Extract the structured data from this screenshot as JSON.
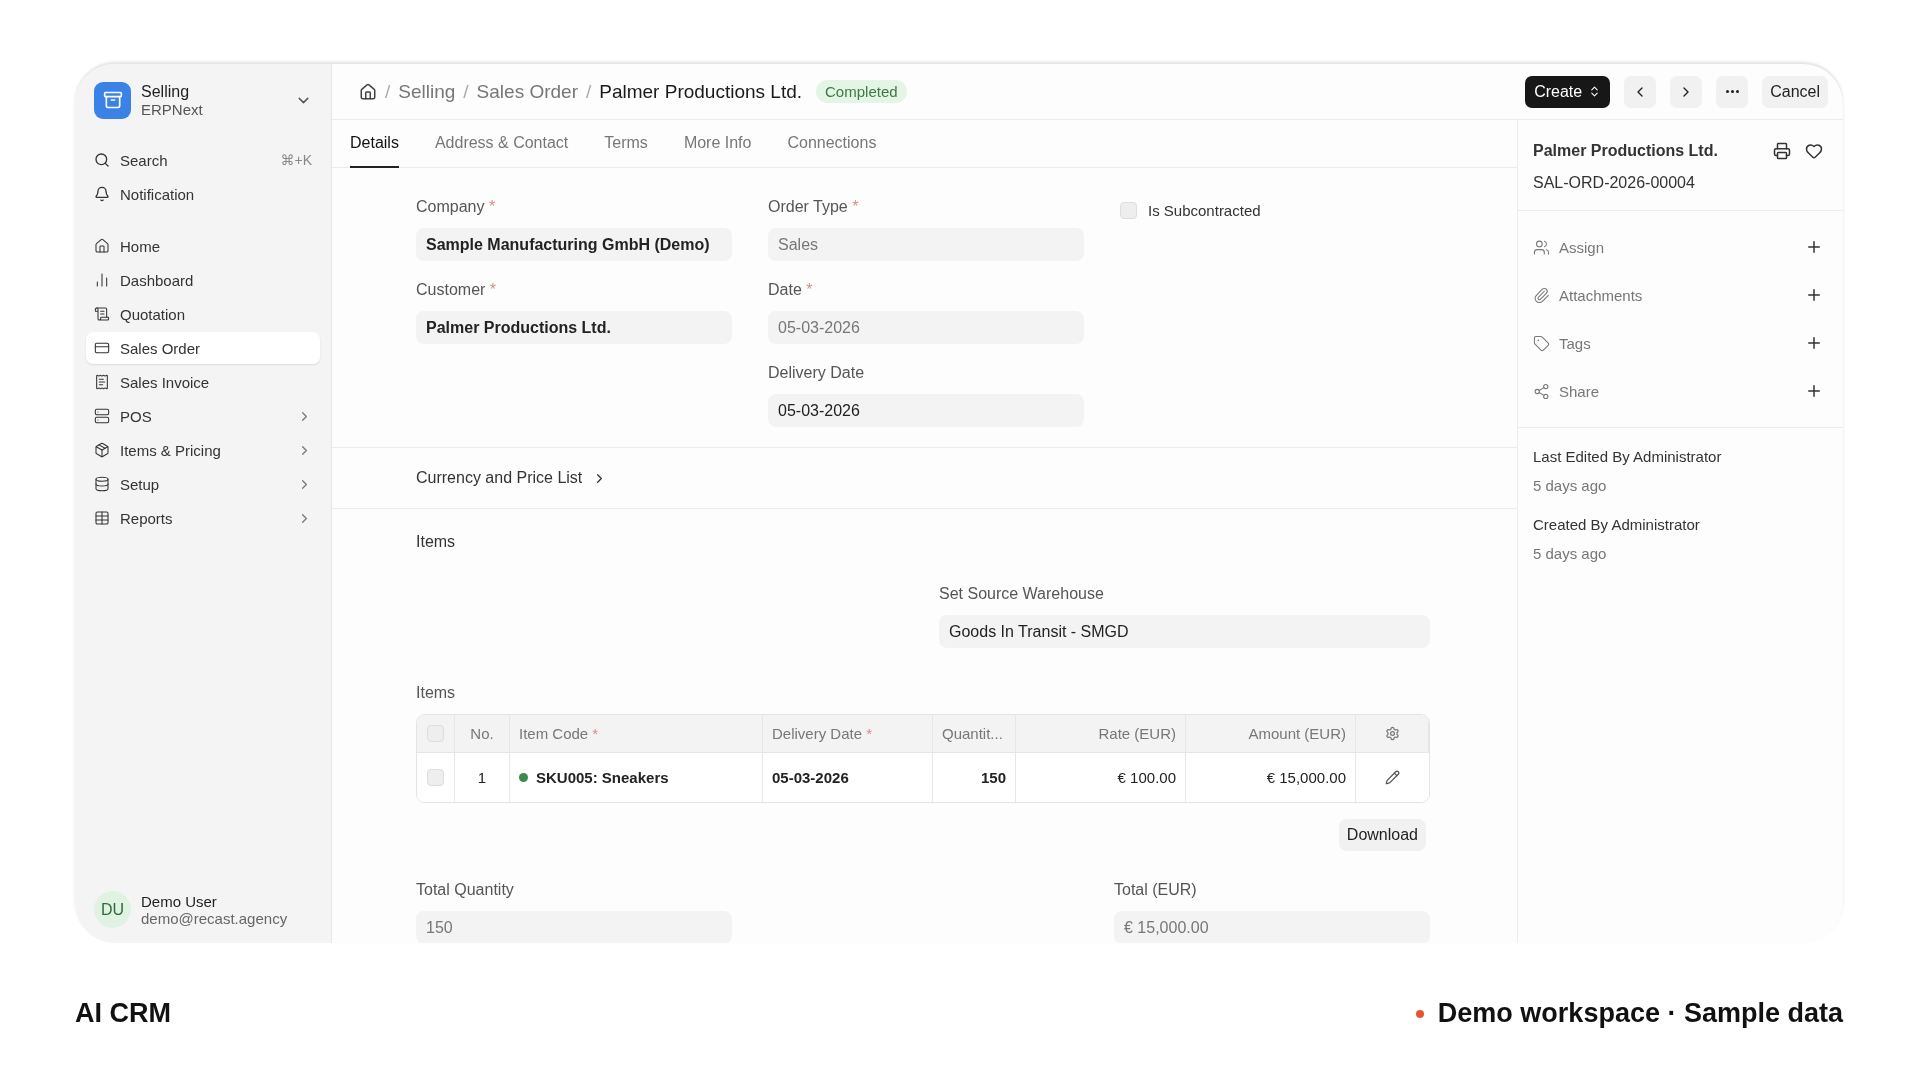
{
  "sidebar": {
    "workspace": {
      "title": "Selling",
      "subtitle": "ERPNext"
    },
    "utilities": [
      {
        "label": "Search",
        "shortcut": "⌘+K"
      },
      {
        "label": "Notification"
      }
    ],
    "items": [
      {
        "label": "Home",
        "kind": "link",
        "selected": false
      },
      {
        "label": "Dashboard",
        "kind": "link",
        "selected": false
      },
      {
        "label": "Quotation",
        "kind": "link",
        "selected": false
      },
      {
        "label": "Sales Order",
        "kind": "link",
        "selected": true
      },
      {
        "label": "Sales Invoice",
        "kind": "link",
        "selected": false
      },
      {
        "label": "POS",
        "kind": "group",
        "selected": false
      },
      {
        "label": "Items & Pricing",
        "kind": "group",
        "selected": false
      },
      {
        "label": "Setup",
        "kind": "group",
        "selected": false
      },
      {
        "label": "Reports",
        "kind": "group",
        "selected": false
      }
    ],
    "user": {
      "initials": "DU",
      "name": "Demo User",
      "email": "demo@recast.agency"
    }
  },
  "breadcrumb": {
    "separator": "/",
    "items": [
      "Selling",
      "Sales Order"
    ],
    "current": "Palmer Productions Ltd.",
    "status": "Completed"
  },
  "actions": {
    "create": "Create",
    "cancel": "Cancel"
  },
  "tabs": [
    {
      "label": "Details",
      "selected": true
    },
    {
      "label": "Address & Contact",
      "selected": false
    },
    {
      "label": "Terms",
      "selected": false
    },
    {
      "label": "More Info",
      "selected": false
    },
    {
      "label": "Connections",
      "selected": false
    }
  ],
  "form_columns": [
    [
      {
        "kind": "link",
        "label": "Company",
        "required_mark": "*",
        "value": "Sample Manufacturing GmbH (Demo)"
      },
      {
        "kind": "link",
        "label": "Customer",
        "required_mark": "*",
        "value": "Palmer Productions Ltd."
      }
    ],
    [
      {
        "kind": "readonly",
        "label": "Order Type",
        "required_mark": "*",
        "value": "Sales"
      },
      {
        "kind": "readonly",
        "label": "Date",
        "required_mark": "*",
        "value": "05-03-2026"
      },
      {
        "kind": "data",
        "label": "Delivery Date",
        "value": "05-03-2026"
      }
    ],
    [
      {
        "kind": "checkbox",
        "label": "Is Subcontracted",
        "checked": false
      }
    ]
  ],
  "collapsible": {
    "label": "Currency and Price List",
    "expanded": false
  },
  "items_section": {
    "title": "Items",
    "warehouse": {
      "label": "Set Source Warehouse",
      "value": "Goods In Transit - SMGD"
    },
    "table": {
      "label": "Items",
      "select_all": false,
      "columns": [
        {
          "label": "No."
        },
        {
          "label": "Item Code",
          "required_mark": "*"
        },
        {
          "label": "Delivery Date",
          "required_mark": "*"
        },
        {
          "label": "Quantit..."
        },
        {
          "label": "Rate (EUR)"
        },
        {
          "label": "Amount (EUR)"
        }
      ],
      "rows": [
        {
          "checked": false,
          "no": "1",
          "item_code": "SKU005: Sneakers",
          "color": "#3b8a4f",
          "delivery_date": "05-03-2026",
          "quantity": "150",
          "rate": "€ 100.00",
          "amount": "€ 15,000.00"
        }
      ]
    },
    "download": "Download",
    "totals": [
      {
        "label": "Total Quantity",
        "value": "150"
      },
      {
        "label": "Total (EUR)",
        "value": "€ 15,000.00"
      }
    ]
  },
  "side_panel": {
    "title": "Palmer Productions Ltd.",
    "name": "SAL-ORD-2026-00004",
    "liked": false,
    "actions": [
      "Assign",
      "Attachments",
      "Tags",
      "Share"
    ],
    "activity": [
      {
        "text": "Last Edited By Administrator",
        "time": "5 days ago"
      },
      {
        "text": "Created By Administrator",
        "time": "5 days ago"
      }
    ]
  },
  "footer": {
    "brand": "AI CRM",
    "note": "Demo workspace · Sample data"
  }
}
